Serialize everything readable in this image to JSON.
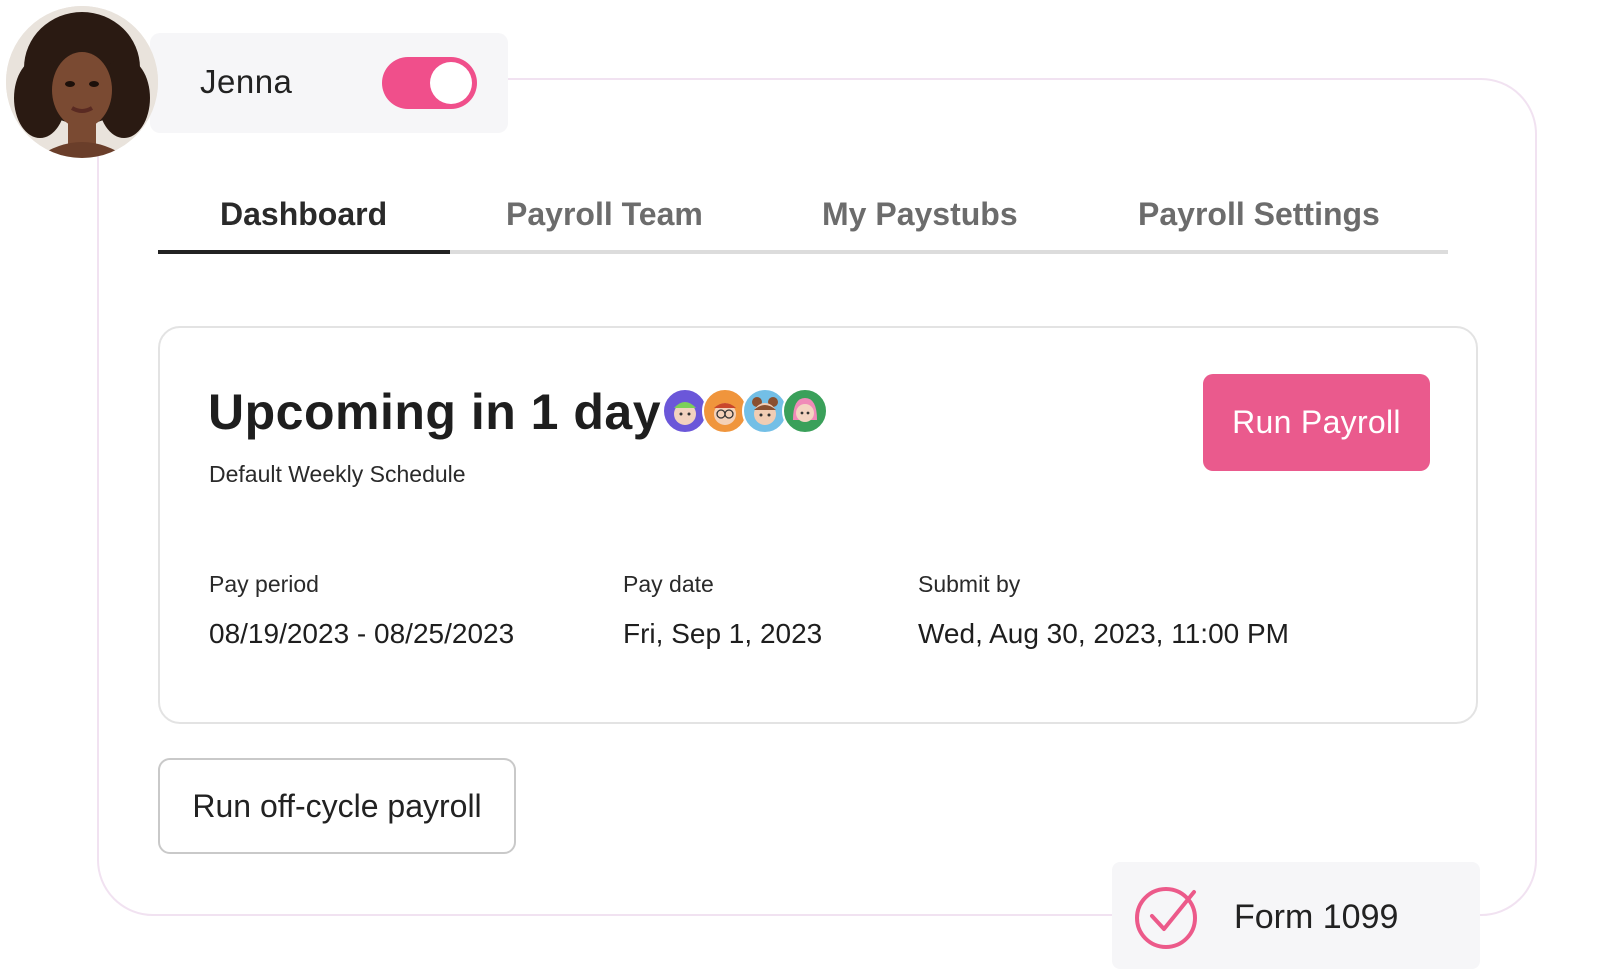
{
  "user": {
    "name": "Jenna",
    "toggle_on": true
  },
  "colors": {
    "accent": "#f04f8b",
    "button_pink": "#ea5a8d"
  },
  "tabs": [
    {
      "label": "Dashboard",
      "active": true
    },
    {
      "label": "Payroll Team",
      "active": false
    },
    {
      "label": "My Paystubs",
      "active": false
    },
    {
      "label": "Payroll Settings",
      "active": false
    }
  ],
  "payroll": {
    "title": "Upcoming in 1 day",
    "subtitle": "Default Weekly Schedule",
    "run_button": "Run Payroll",
    "team_avatars": [
      "memoji-avatar-1",
      "memoji-avatar-2",
      "memoji-avatar-3",
      "memoji-avatar-4"
    ],
    "fields": [
      {
        "label": "Pay period",
        "value": "08/19/2023 - 08/25/2023"
      },
      {
        "label": "Pay date",
        "value": "Fri, Sep 1, 2023"
      },
      {
        "label": "Submit by",
        "value": "Wed, Aug 30, 2023, 11:00 PM"
      }
    ]
  },
  "actions": {
    "offcycle_button": "Run off-cycle payroll"
  },
  "badge": {
    "icon": "check-circle-icon",
    "label": "Form 1099"
  }
}
